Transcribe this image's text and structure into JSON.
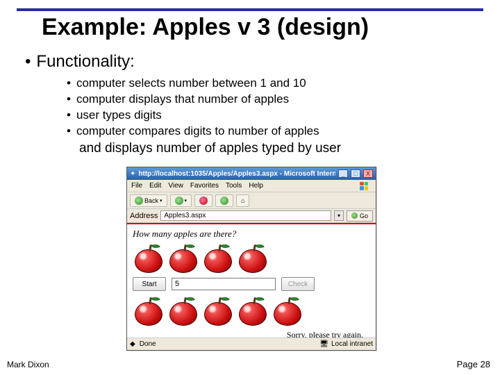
{
  "slide": {
    "title": "Example: Apples v 3 (design)",
    "heading": "Functionality:",
    "bullets": [
      "computer selects number between 1 and 10",
      "computer displays that number of apples",
      "user types digits",
      "computer compares digits to number of apples"
    ],
    "result_line": "and displays number of apples typed by user",
    "footer_author": "Mark Dixon",
    "footer_page": "Page 28"
  },
  "browser": {
    "titlebar": "http://localhost:1035/Apples/Apples3.aspx - Microsoft Intern...",
    "controls": {
      "min": "_",
      "max": "□",
      "close": "X"
    },
    "menus": [
      "File",
      "Edit",
      "View",
      "Favorites",
      "Tools",
      "Help"
    ],
    "toolbar": {
      "back": "Back",
      "forward": ""
    },
    "address_label": "Address",
    "address_value": "Apples3.aspx",
    "go_label": "Go",
    "page": {
      "question": "How many apples are there?",
      "apple_count": 5,
      "start_button": "Start",
      "input_value": "5",
      "check_button": "Check",
      "message": "Sorry, please try again."
    },
    "status": {
      "left": "Done",
      "right": "Local intranet"
    }
  }
}
